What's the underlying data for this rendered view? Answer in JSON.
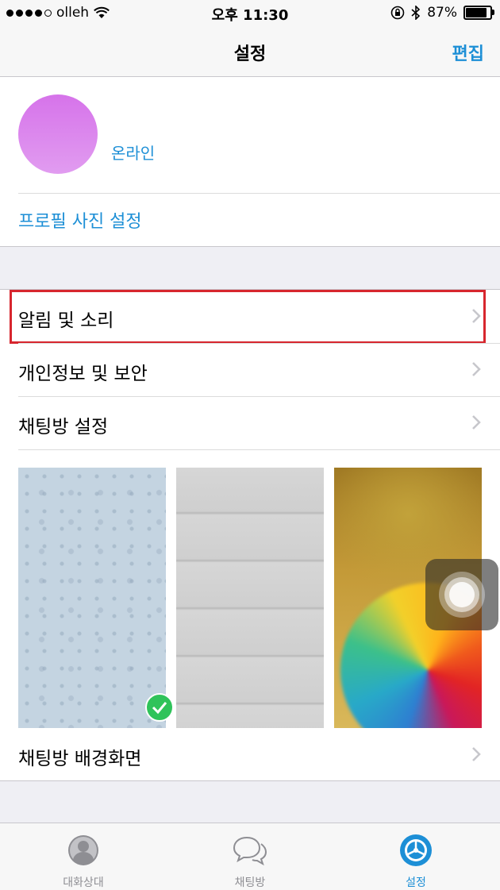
{
  "status_bar": {
    "carrier": "olleh",
    "time": "오후 11:30",
    "battery": "87%"
  },
  "nav": {
    "title": "설정",
    "edit": "편집"
  },
  "profile": {
    "status": "온라인",
    "photo_setting": "프로필 사진 설정"
  },
  "settings": [
    {
      "label": "알림 및 소리",
      "highlighted": true
    },
    {
      "label": "개인정보 및 보안",
      "highlighted": false
    },
    {
      "label": "채팅방 설정",
      "highlighted": false
    }
  ],
  "wallpaper": {
    "label": "채팅방 배경화면",
    "selected_index": 0
  },
  "tabs": [
    {
      "label": "대화상대",
      "icon": "contacts-icon",
      "active": false
    },
    {
      "label": "채팅방",
      "icon": "chats-icon",
      "active": false
    },
    {
      "label": "설정",
      "icon": "settings-icon",
      "active": true
    }
  ],
  "colors": {
    "accent": "#1d8fd6",
    "highlight_border": "#d7262e",
    "check": "#2fc35a"
  }
}
